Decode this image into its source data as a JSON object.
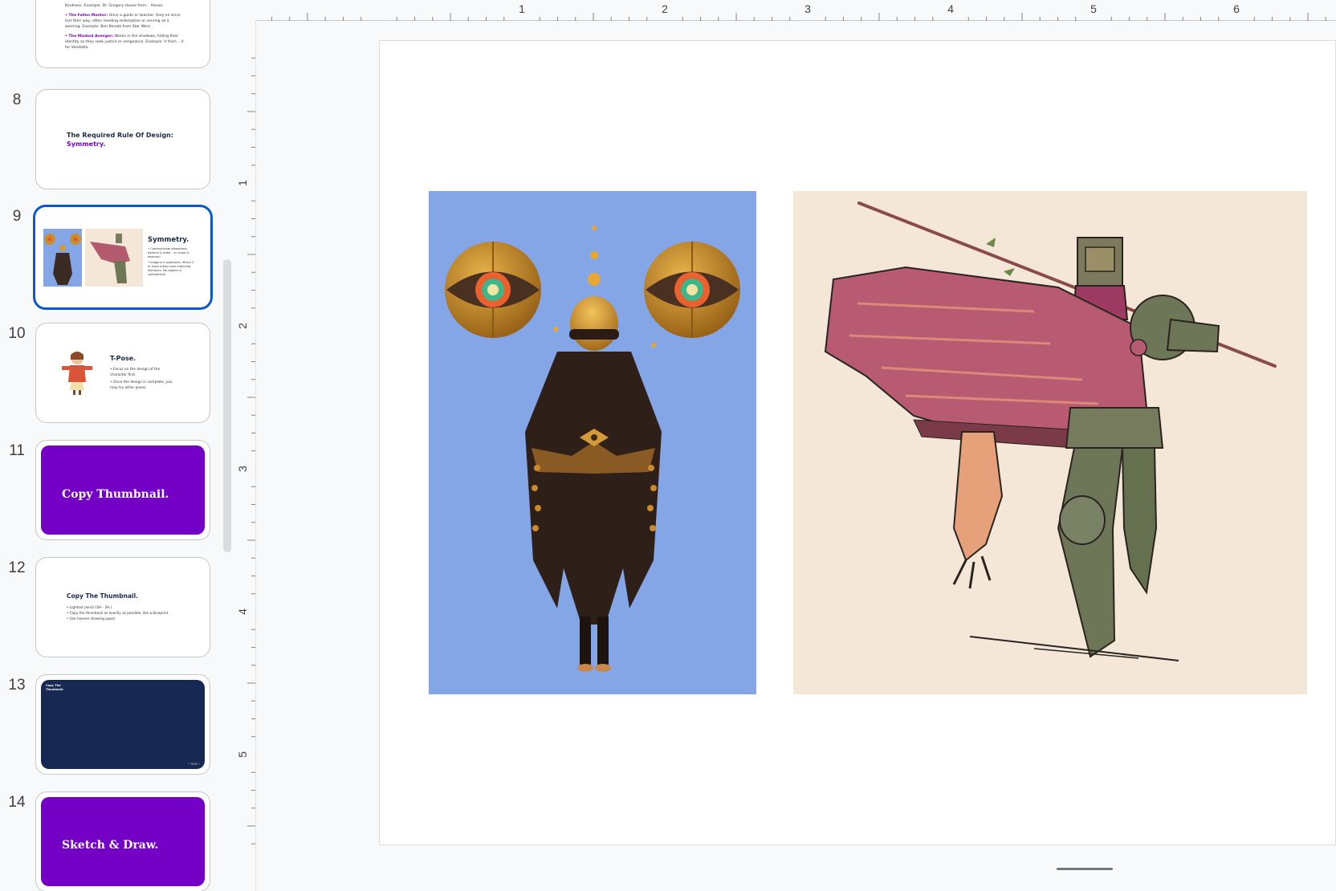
{
  "ruler": {
    "horizontal_labels": [
      "1",
      "2",
      "3",
      "4",
      "5",
      "6"
    ],
    "vertical_labels": [
      "1",
      "2",
      "3",
      "4",
      "5"
    ]
  },
  "filmstrip": {
    "slides": [
      {
        "number": "",
        "lines": [
          {
            "lead": "",
            "text": "Kindness. Example: Dr. Gregory House from... House."
          },
          {
            "lead": "• The Fallen Mentor:",
            "text": " Once a guide or teacher, they've since lost their way, often needing redemption or serving as a warning. Example: Ben Kenobi from Star Wars."
          },
          {
            "lead": "• The Masked Avenger:",
            "text": " Works in the shadows, hiding their identity as they seek justice or vengeance. Example: V from... V for Vendetta."
          }
        ]
      },
      {
        "number": "8",
        "title": "The Required Rule Of Design:",
        "title_accent": "Symmetry."
      },
      {
        "number": "9",
        "title": "Symmetry.",
        "bullets": [
          "• Communicate steadiness, balance & order - or chaos & disarray!",
          "• Imagine 4 quadrants. Which 2 or more areas have matching elements. No subject is symmetrical"
        ]
      },
      {
        "number": "10",
        "title": "T-Pose.",
        "bullets": [
          "• Focus on the design of the character first.",
          "• Once the design is complete, you may try other poses."
        ]
      },
      {
        "number": "11",
        "title": "Copy Thumbnail."
      },
      {
        "number": "12",
        "title": "Copy The Thumbnail.",
        "bullets": [
          "• Lightest pencil (5H - 2H.)",
          "• Copy the thumbnail as exactly as possible, like a blueprint.",
          "• Use heavier drawing paper."
        ]
      },
      {
        "number": "13",
        "title": "Copy The Thumbnail.",
        "footer": "• TENS •"
      },
      {
        "number": "14",
        "title": "Sketch & Draw."
      }
    ]
  },
  "main_slide": {
    "images": [
      {
        "name": "masked-figure-illustration",
        "background": "#84a6e6"
      },
      {
        "name": "armored-knight-illustration",
        "background": "#f4e7d7"
      }
    ]
  },
  "colors": {
    "accent": "#0b57d0",
    "purple": "#7300c4",
    "navy": "#172853"
  }
}
